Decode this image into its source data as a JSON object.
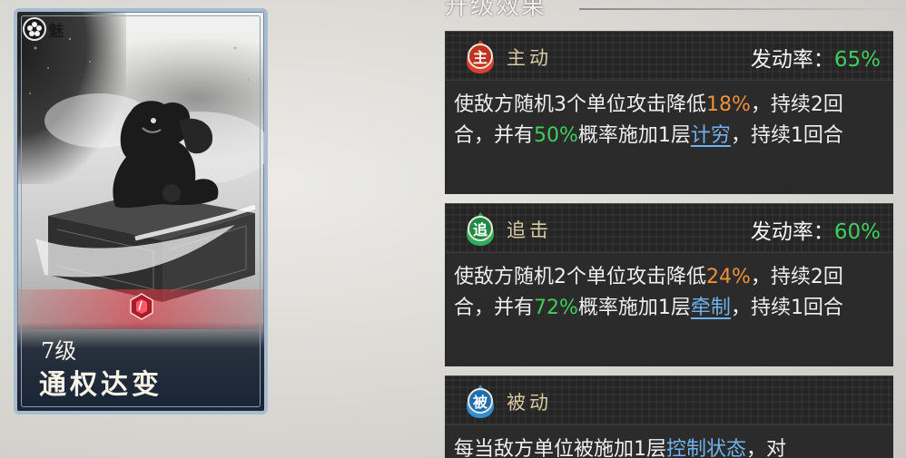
{
  "card": {
    "badge_text": "魅",
    "level": "7级",
    "name": "通权达变"
  },
  "section": {
    "title": "升级效果"
  },
  "skills": [
    {
      "icon_char": "主",
      "icon": "fire-red-icon",
      "type": "主动",
      "rate_label": "发动率：",
      "rate_value": "65%",
      "desc": {
        "p1": "使敌方随机3个单位攻击降低",
        "v1": "18%",
        "p2": "，持续2回合，并有",
        "v2": "50%",
        "p3": "概率施加1层",
        "link": "计穷",
        "p4": "，持续1回合"
      }
    },
    {
      "icon_char": "追",
      "icon": "fire-green-icon",
      "type": "追击",
      "rate_label": "发动率：",
      "rate_value": "60%",
      "desc": {
        "p1": "使敌方随机2个单位攻击降低",
        "v1": "24%",
        "p2": "，持续2回合，并有",
        "v2": "72%",
        "p3": "概率施加1层",
        "link": "牵制",
        "p4": "，持续1回合"
      }
    },
    {
      "icon_char": "被",
      "icon": "fire-blue-icon",
      "type": "被动",
      "desc": {
        "p1": "每当敌方单位被施加1层",
        "link": "控制状态",
        "p2": "，对"
      }
    }
  ],
  "colors": {
    "accent_green": "#3fce5a",
    "accent_orange": "#f0903a",
    "link_blue": "#6fb2ee",
    "card_border": "#a9bccf"
  }
}
